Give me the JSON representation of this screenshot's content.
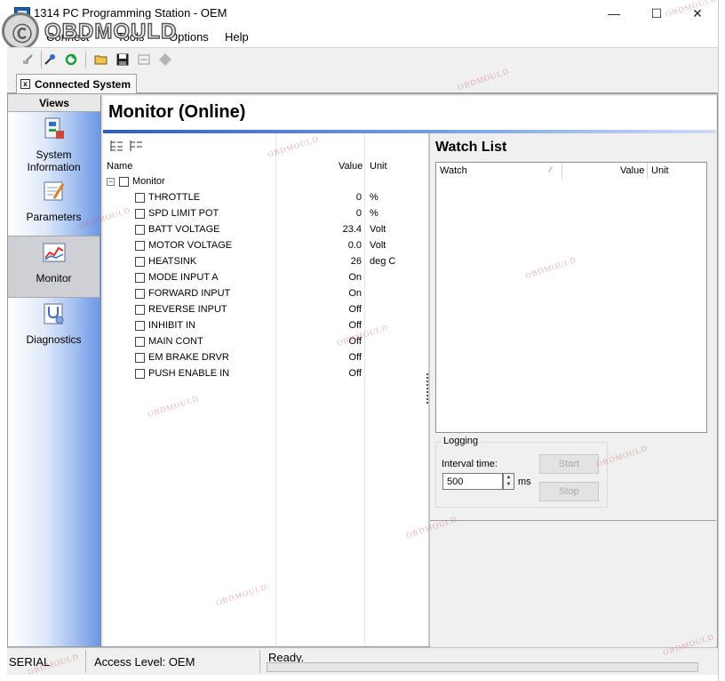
{
  "window": {
    "title": "1314 PC Programming Station - OEM",
    "minimize": "—",
    "maximize": "☐",
    "close": "✕"
  },
  "logo": {
    "text": "OBDMOULD",
    "badge": "Ⓒ"
  },
  "menu": {
    "items": [
      {
        "label": "Connect"
      },
      {
        "label": "Tools"
      },
      {
        "label": "Options"
      },
      {
        "label": "Help"
      }
    ]
  },
  "toolbar": {
    "buttons": [
      "connect-icon",
      "disconnect-icon",
      "refresh-icon",
      "open-folder-icon",
      "save-icon",
      "program-icon",
      "eraser-icon"
    ]
  },
  "tab": {
    "label": "Connected System",
    "close": "x"
  },
  "sidebar": {
    "header": "Views",
    "items": [
      {
        "label": "System Information",
        "icon": "system-information-icon"
      },
      {
        "label": "Parameters",
        "icon": "parameters-icon"
      },
      {
        "label": "Monitor",
        "icon": "monitor-chart-icon",
        "selected": true
      },
      {
        "label": "Diagnostics",
        "icon": "diagnostics-stethoscope-icon"
      }
    ]
  },
  "main": {
    "title": "Monitor (Online)"
  },
  "tree": {
    "headers": {
      "name": "Name",
      "value": "Value",
      "unit": "Unit"
    },
    "root": {
      "label": "Monitor",
      "expander": "−"
    },
    "rows": [
      {
        "name": "THROTTLE",
        "value": "0",
        "unit": "%"
      },
      {
        "name": "SPD LIMIT POT",
        "value": "0",
        "unit": "%"
      },
      {
        "name": "BATT VOLTAGE",
        "value": "23.4",
        "unit": "Volt"
      },
      {
        "name": "MOTOR VOLTAGE",
        "value": "0.0",
        "unit": "Volt"
      },
      {
        "name": "HEATSINK",
        "value": "26",
        "unit": "deg C"
      },
      {
        "name": "MODE INPUT A",
        "value": "On",
        "unit": ""
      },
      {
        "name": "FORWARD INPUT",
        "value": "On",
        "unit": ""
      },
      {
        "name": "REVERSE INPUT",
        "value": "Off",
        "unit": ""
      },
      {
        "name": "INHIBIT IN",
        "value": "Off",
        "unit": ""
      },
      {
        "name": "MAIN CONT",
        "value": "Off",
        "unit": ""
      },
      {
        "name": "EM BRAKE DRVR",
        "value": "Off",
        "unit": ""
      },
      {
        "name": "PUSH ENABLE IN",
        "value": "Off",
        "unit": ""
      }
    ]
  },
  "watch": {
    "title": "Watch List",
    "headers": {
      "watch": "Watch",
      "value": "Value",
      "unit": "Unit"
    }
  },
  "logging": {
    "legend": "Logging",
    "interval_label": "Interval time:",
    "interval_value": "500",
    "unit": "ms",
    "start": "Start",
    "stop": "Stop"
  },
  "status": {
    "port": "SERIAL",
    "access": "Access Level: OEM",
    "state": "Ready."
  },
  "watermark": "OBDMOULD",
  "colors": {
    "accent": "#2b5fbf",
    "sidebar_gradient_end": "#6b97e6"
  }
}
